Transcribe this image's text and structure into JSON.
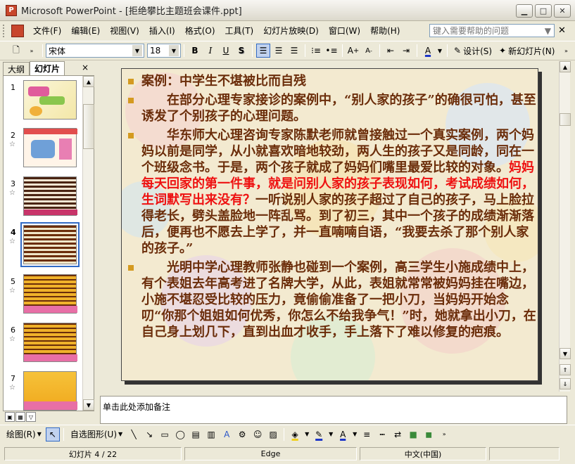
{
  "window": {
    "title": "Microsoft PowerPoint - [拒绝攀比主题班会课件.ppt]",
    "app_icon_text": "P"
  },
  "menu": {
    "items": [
      "文件(F)",
      "编辑(E)",
      "视图(V)",
      "插入(I)",
      "格式(O)",
      "工具(T)",
      "幻灯片放映(D)",
      "窗口(W)",
      "帮助(H)"
    ],
    "help_placeholder": "键入需要帮助的问题"
  },
  "format": {
    "font": "宋体",
    "size": "18",
    "bold": "B",
    "italic": "I",
    "underline": "U",
    "shadow": "S",
    "design": "设计(S)",
    "new_slide": "新幻灯片(N)"
  },
  "pane": {
    "tab_outline": "大纲",
    "tab_slides": "幻灯片",
    "close": "×",
    "thumbs": [
      {
        "num": "1",
        "star": ""
      },
      {
        "num": "2",
        "star": "☆"
      },
      {
        "num": "3",
        "star": "☆"
      },
      {
        "num": "4",
        "star": "☆"
      },
      {
        "num": "5",
        "star": "☆"
      },
      {
        "num": "6",
        "star": "☆"
      },
      {
        "num": "7",
        "star": "☆"
      }
    ]
  },
  "slide": {
    "p1": "案例：中学生不堪被比而自残",
    "p2": "在部分心理专家接诊的案例中，“别人家的孩子”的确很可怕，甚至诱发了个别孩子的心理问题。",
    "p3a": "华东师大心理咨询专家陈默老师就曾接触过一个真实案例，两个妈妈以前是同学，从小就喜欢暗地较劲，两人生的孩子又是同龄，同在一个班级念书。于是，两个孩子就成了妈妈们嘴里最爱比较的对象。",
    "p3b": "妈妈每天回家的第一件事，就是问别人家的孩子表现如何，考试成绩如何，生词默写出来没有？",
    "p3c": "一听说别人家的孩子超过了自己的孩子，马上脸拉得老长，劈头盖脸地一阵乱骂。到了初三，其中一个孩子的成绩渐渐落后，便再也不愿去上学了，并一直喃喃自语，“我要去杀了那个别人家的孩子。”",
    "p4": "光明中学心理教师张静也碰到一个案例，高三学生小施成绩中上，有个表姐去年高考进了名牌大学，从此，表姐就常常被妈妈挂在嘴边，小施不堪忍受比较的压力，竟偷偷准备了一把小刀，当妈妈开始念叨“你那个姐姐如何优秀，你怎么不给我争气！”时，她就拿出小刀，在自己身上划几下，直到出血才收手，手上落下了难以修复的疤痕。"
  },
  "notes": {
    "placeholder": "单击此处添加备注"
  },
  "draw": {
    "draw_label": "绘图(R)",
    "autoshape_label": "自选图形(U)"
  },
  "status": {
    "slide": "幻灯片 4 / 22",
    "design": "Edge",
    "lang": "中文(中国)"
  }
}
